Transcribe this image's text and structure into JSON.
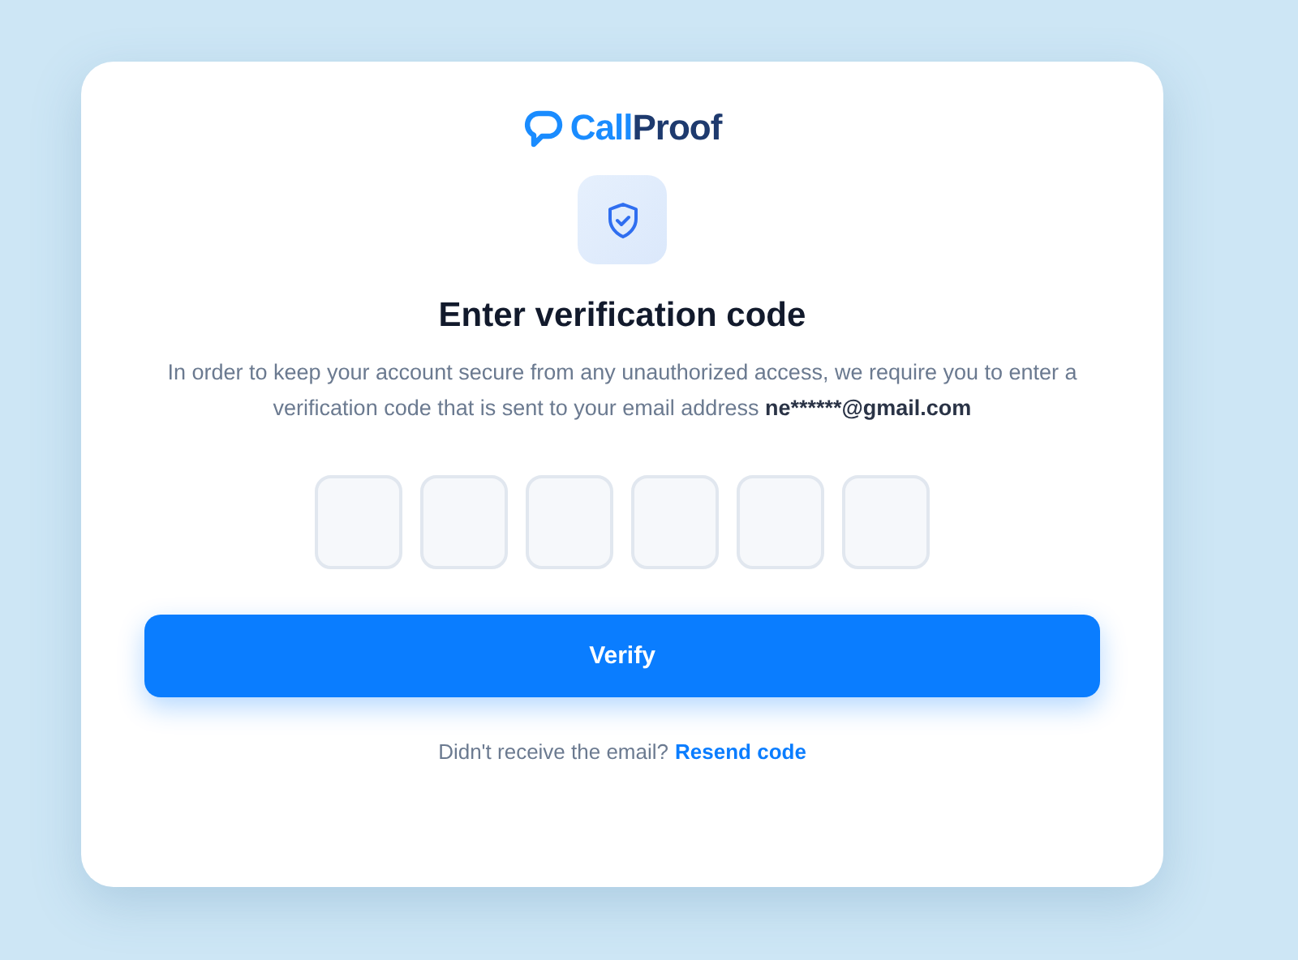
{
  "logo": {
    "first": "Call",
    "second": "Proof"
  },
  "title": "Enter verification code",
  "description": {
    "text": "In order to keep your account secure from any unauthorized access, we require you to enter a verification code that is sent to your email address",
    "email": "ne******@gmail.com"
  },
  "code_fields": [
    {
      "kind": "digit"
    },
    {
      "kind": "digit"
    },
    {
      "kind": "digit"
    },
    {
      "kind": "digit"
    },
    {
      "kind": "digit"
    },
    {
      "kind": "digit"
    }
  ],
  "verify_button": "Verify",
  "resend": {
    "prompt": "Didn't receive the email?",
    "link": "Resend code"
  }
}
